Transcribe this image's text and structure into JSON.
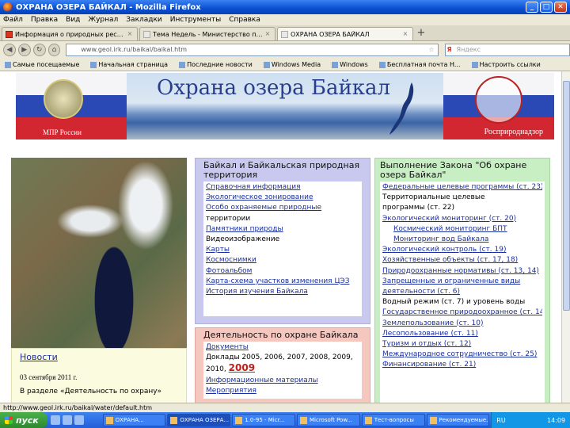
{
  "window": {
    "title": "ОХРАНА ОЗЕРА БАЙКАЛ - Mozilla Firefox",
    "minimize": "_",
    "maximize": "□",
    "close": "✕"
  },
  "menu": [
    "Файл",
    "Правка",
    "Вид",
    "Журнал",
    "Закладки",
    "Инструменты",
    "Справка"
  ],
  "tabs": [
    {
      "label": "Информация о природных ресурсах ...",
      "active": false
    },
    {
      "label": "Тема Недель - Министерство природ...",
      "active": false
    },
    {
      "label": "ОХРАНА ОЗЕРА БАЙКАЛ",
      "active": true
    }
  ],
  "new_tab": "+",
  "tab_close": "×",
  "nav": {
    "url": "www.geol.irk.ru/baikal/baikal.htm",
    "search_placeholder": "Яндекс",
    "back": "◀",
    "forward": "▶",
    "reload": "↻",
    "home": "⌂",
    "search_glyph": "Я",
    "bookmark_star": "☆"
  },
  "bookmarks": [
    "Самые посещаемые",
    "Начальная страница",
    "Последние новости",
    "Windows Media",
    "Windows",
    "Бесплатная почта H...",
    "Настроить ссылки"
  ],
  "banner": {
    "title": "Охрана озера Байкал",
    "left_caption": "МПР России",
    "right_caption": "Росприроднадзор"
  },
  "news": {
    "title": "Новости",
    "date": "03 сентября 2011 г.",
    "text": "В разделе «Деятельность по охрану»"
  },
  "col2a": {
    "heading": "Байкал и Байкальская природная территория",
    "links": [
      {
        "text": "Справочная информация",
        "style": "link"
      },
      {
        "text": "Экологическое зонирование",
        "style": "link"
      },
      {
        "text": "Особо охраняемые природные",
        "style": "link"
      },
      {
        "text": "территории",
        "style": "plain"
      },
      {
        "text": "Памятники природы",
        "style": "link"
      },
      {
        "text": "Видеоизображение",
        "style": "plain"
      },
      {
        "text": "Карты",
        "style": "link"
      },
      {
        "text": "Космоснимки",
        "style": "link"
      },
      {
        "text": "Фотоальбом",
        "style": "link"
      },
      {
        "text": "Карта-схема участков изменения ЦЭЗ",
        "style": "link"
      },
      {
        "text": "История изучения Байкала",
        "style": "link"
      }
    ]
  },
  "col2b": {
    "heading": "Деятельность по охране Байкала",
    "documents": "Документы",
    "doc_years_line1": "Доклады 2005, 2006, 2007, 2008, 2009,",
    "doc_years_line2": "2010,",
    "doc_year_highlight": "2009",
    "links": [
      "Информационные материалы",
      "Мероприятия"
    ]
  },
  "col3": {
    "heading": "Выполнение Закона \"Об охране озера Байкал\"",
    "links": [
      {
        "text": "Федеральные целевые программы (ст. 23)",
        "style": "link"
      },
      {
        "text": "Территориальные целевые",
        "style": "plain"
      },
      {
        "text": "программы (ст. 22)",
        "style": "plain"
      },
      {
        "text": "Экологический мониторинг (ст. 20)",
        "style": "link"
      },
      {
        "text": "Космический мониторинг БПТ",
        "style": "sub"
      },
      {
        "text": "Мониторинг вод Байкала",
        "style": "sub"
      },
      {
        "text": "Экологический контроль (ст. 19)",
        "style": "link"
      },
      {
        "text": "Хозяйственные объекты (ст. 17, 18)",
        "style": "link"
      },
      {
        "text": "Природоохранные нормативы (ст. 13, 14)",
        "style": "link"
      },
      {
        "text": "Запрещенные и ограниченные виды",
        "style": "link"
      },
      {
        "text": "деятельности (ст. 6)",
        "style": "link"
      },
      {
        "text": "Водный режим (ст. 7) и уровень воды",
        "style": "plain"
      },
      {
        "text": "Государственное природоохранное (ст. 14)",
        "style": "link"
      },
      {
        "text": "Землепользование (ст. 10)",
        "style": "link"
      },
      {
        "text": "Лесопользование (ст. 11)",
        "style": "link"
      },
      {
        "text": "Туризм и отдых (ст. 12)",
        "style": "link"
      },
      {
        "text": "Международное сотрудничество (ст. 25)",
        "style": "link"
      },
      {
        "text": "Финансирование (ст. 21)",
        "style": "link"
      }
    ]
  },
  "status": "http://www.geol.irk.ru/baikal/water/default.htm",
  "taskbar": {
    "start": "пуск",
    "tasks": [
      "ОХРАНА...",
      "ОХРАНА ОЗЕРА...",
      "1.0-95 - Micr...",
      "Microsoft Pow...",
      "Тест-вопросы",
      "Рекомендуемые..."
    ],
    "lang": "RU",
    "time": "14:09"
  },
  "colors": {
    "accent": "#245ed8",
    "link": "#1a2fa0",
    "col2a_bg": "#c9c9ef",
    "col2b_bg": "#f6c7bf",
    "col3_bg": "#c8efc4",
    "news_bg": "#fbfbdf"
  }
}
